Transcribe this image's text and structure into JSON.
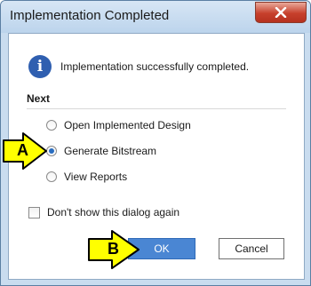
{
  "dialog": {
    "title": "Implementation Completed",
    "message": "Implementation successfully completed.",
    "section_label": "Next",
    "options": [
      {
        "label": "Open Implemented Design",
        "selected": false
      },
      {
        "label": "Generate Bitstream",
        "selected": true
      },
      {
        "label": "View Reports",
        "selected": false
      }
    ],
    "dont_show_label": "Don't show this dialog again",
    "dont_show_checked": false,
    "ok_label": "OK",
    "cancel_label": "Cancel"
  },
  "annotations": {
    "marker_a": "A",
    "marker_b": "B"
  },
  "colors": {
    "marker_fill": "#ffff00",
    "ok_button": "#4a86d3",
    "close_button": "#c7402c"
  }
}
